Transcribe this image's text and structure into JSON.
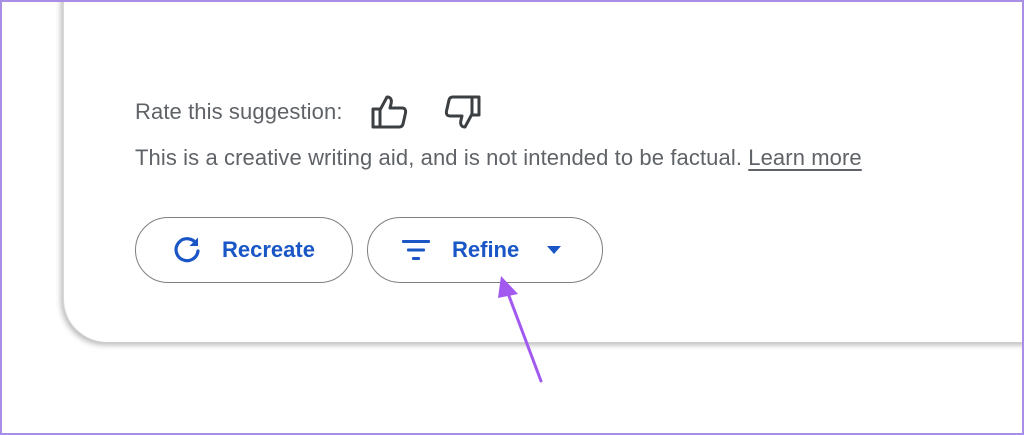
{
  "rating": {
    "label": "Rate this suggestion:",
    "thumbs_up_icon": "thumbs-up-icon",
    "thumbs_down_icon": "thumbs-down-icon"
  },
  "disclaimer": {
    "text": "This is a creative writing aid, and is not intended to be factual.",
    "link_label": "Learn more"
  },
  "actions": {
    "recreate": {
      "label": "Recreate",
      "icon": "refresh-icon"
    },
    "refine": {
      "label": "Refine",
      "icon": "filter-icon",
      "dropdown_icon": "caret-down-icon"
    }
  },
  "colors": {
    "accent": "#1a56c6",
    "text_secondary": "#5f6368",
    "annotation_arrow": "#a259f0",
    "frame_border": "#a98ee6"
  }
}
